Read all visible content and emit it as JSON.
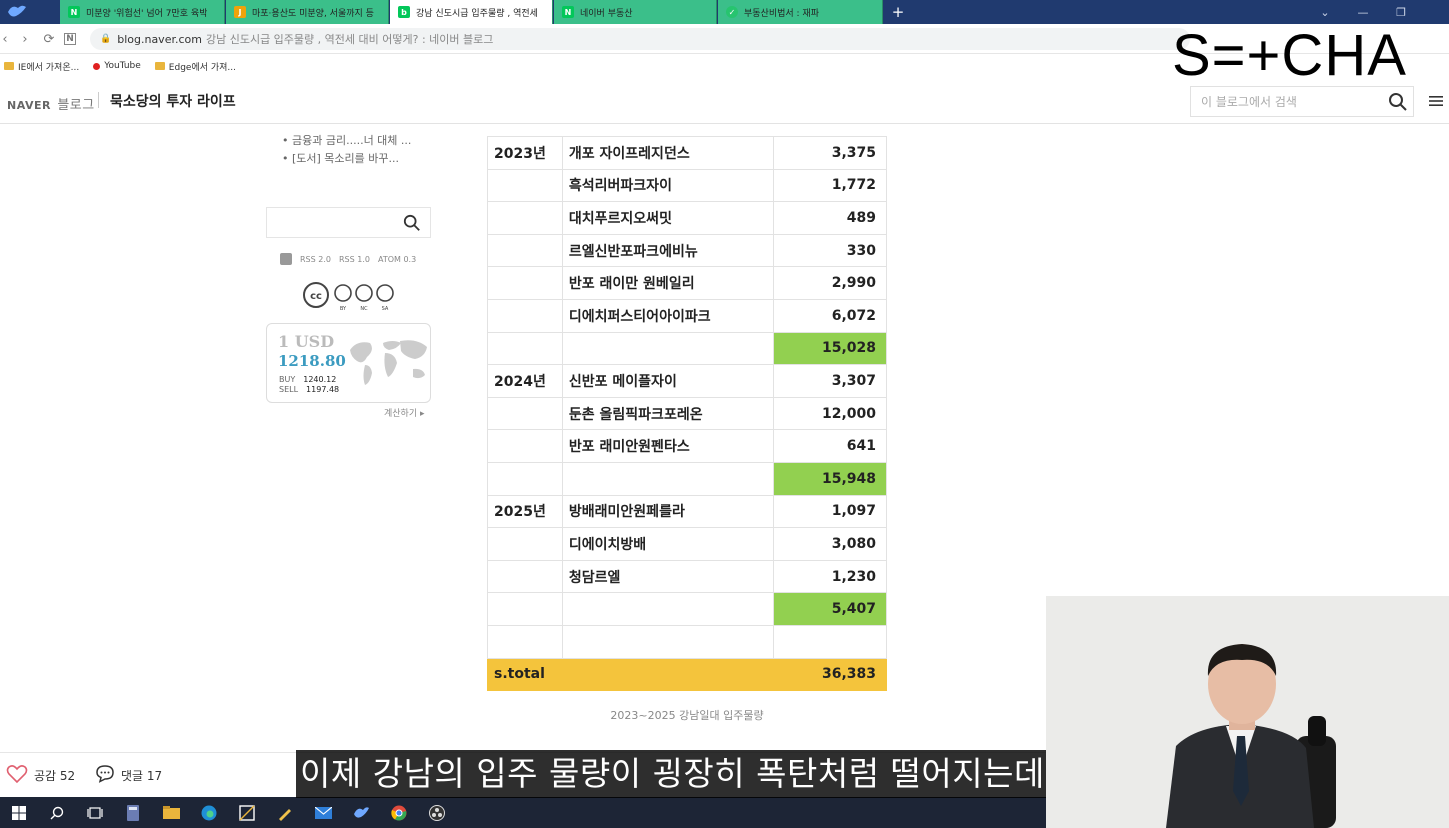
{
  "browser": {
    "tabs": [
      {
        "label": "미분양 '위험선' 넘어 7만호 육박",
        "icon": "naver-n-icon",
        "color": "#03c75a"
      },
      {
        "label": "마포·용산도 미분양, 서울까지 등",
        "icon": "j-news-icon",
        "color": "#f0a30a"
      },
      {
        "label": "강남 신도시급 입주물량 , 역전세",
        "icon": "naver-blog-icon",
        "color": "#03c75a",
        "active": true
      },
      {
        "label": "네이버 부동산",
        "icon": "naver-n-icon",
        "color": "#03c75a"
      },
      {
        "label": "부동산비법서 : 재파",
        "icon": "green-circle-icon",
        "color": "#27c46f"
      }
    ],
    "new_tab": "+",
    "url_domain": "blog.naver.com",
    "url_rest": "강남 신도시급 입주물량 , 역전세 대비 어떻게? : 네이버 블로그",
    "bookmarks": [
      {
        "label": "IE에서 가져온...",
        "icon": "folder-icon"
      },
      {
        "label": "YouTube",
        "icon": "youtube-icon"
      },
      {
        "label": "Edge에서 가져...",
        "icon": "folder-icon"
      }
    ]
  },
  "brand": "S=+CHA",
  "blog": {
    "logo_naver": "NAVER",
    "logo_blog": "블로그",
    "title": "묵소당의 투자 라이프",
    "search_placeholder": "이 블로그에서 검색"
  },
  "sidebar": {
    "links": [
      "• 금융과 금리.....너 대체 ...",
      "• [도서] 목소리를 바꾸..."
    ],
    "rss": [
      "RSS 2.0",
      "RSS 1.0",
      "ATOM 0.3"
    ],
    "cc_labels": [
      "BY",
      "NC",
      "SA"
    ],
    "currency": {
      "unit": "1 USD",
      "rate": "1218.80",
      "buy_label": "BUY",
      "buy": "1240.12",
      "sell_label": "SELL",
      "sell": "1197.48",
      "calc": "계산하기 ▸"
    }
  },
  "table": {
    "rows": [
      {
        "year": "2023년",
        "name": "개포 자이프레지던스",
        "value": "3,375"
      },
      {
        "year": "",
        "name": "흑석리버파크자이",
        "value": "1,772"
      },
      {
        "year": "",
        "name": "대치푸르지오써밋",
        "value": "489"
      },
      {
        "year": "",
        "name": "르엘신반포파크에비뉴",
        "value": "330"
      },
      {
        "year": "",
        "name": "반포 래이만 원베일리",
        "value": "2,990"
      },
      {
        "year": "",
        "name": "디에치퍼스티어아이파크",
        "value": "6,072"
      },
      {
        "year": "",
        "name": "",
        "value": "15,028",
        "subtotal": true
      },
      {
        "year": "2024년",
        "name": "신반포 메이플자이",
        "value": "3,307"
      },
      {
        "year": "",
        "name": "둔촌 올림픽파크포레온",
        "value": "12,000"
      },
      {
        "year": "",
        "name": "반포 래미안원펜타스",
        "value": "641"
      },
      {
        "year": "",
        "name": "",
        "value": "15,948",
        "subtotal": true
      },
      {
        "year": "2025년",
        "name": "방배래미안원페를라",
        "value": "1,097"
      },
      {
        "year": "",
        "name": "디에이치방배",
        "value": "3,080"
      },
      {
        "year": "",
        "name": "청담르엘",
        "value": "1,230"
      },
      {
        "year": "",
        "name": "",
        "value": "5,407",
        "subtotal": true
      },
      {
        "year": "",
        "name": "",
        "value": ""
      }
    ],
    "total_label": "s.total",
    "total_value": "36,383",
    "caption": "2023~2025 강남일대 입주물량",
    "subtotal_color": "#92d050",
    "total_color": "#f4c43c"
  },
  "engagement": {
    "like_label": "공감 52",
    "comment_label": "댓글 17"
  },
  "subtitle": "이제 강남의 입주 물량이 굉장히 폭탄처럼 떨어지는데요"
}
